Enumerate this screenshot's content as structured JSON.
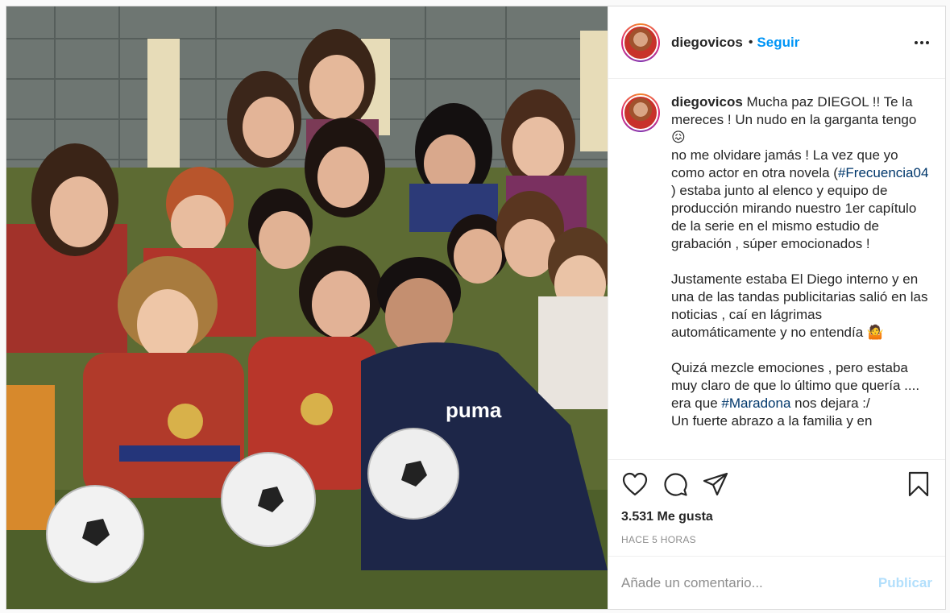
{
  "post": {
    "username": "diegovicos",
    "follow_label": "Seguir",
    "dot": "•",
    "caption": {
      "username": "diegovicos",
      "line1": " Mucha paz DIEGOL !! Te la mereces ! Un nudo en la garganta tengo 😖",
      "line2": "no me olvidare jamás ! La vez que yo como actor en otra novela (",
      "hashtag1": "#Frecuencia04",
      "line2b": " ) estaba junto al elenco y equipo de producción mirando nuestro 1er capítulo de la serie en el mismo estudio de grabación , súper emocionados !",
      "para2": "Justamente estaba El Diego interno y en una de las tandas publicitarias salió en las noticias , caí en lágrimas automáticamente y no entendía 🤷",
      "para3a": "Quizá mezcle emociones , pero estaba muy claro de que lo último que quería .... era que ",
      "hashtag2": "#Maradona",
      "para3b": " nos dejara :/",
      "para4": "Un fuerte abrazo a la familia y en"
    },
    "likes": "3.531 Me gusta",
    "time": "HACE 5 HORAS",
    "comment_placeholder": "Añade un comentario...",
    "publish_label": "Publicar"
  },
  "icons": {
    "like": "heart-icon",
    "comment": "comment-bubble-icon",
    "share": "paper-plane-icon",
    "save": "bookmark-icon",
    "more": "more-dots-icon"
  },
  "colors": {
    "link": "#00376b",
    "follow": "#0095f6",
    "publish_disabled": "#b2dffc",
    "muted": "#8e8e8e"
  }
}
